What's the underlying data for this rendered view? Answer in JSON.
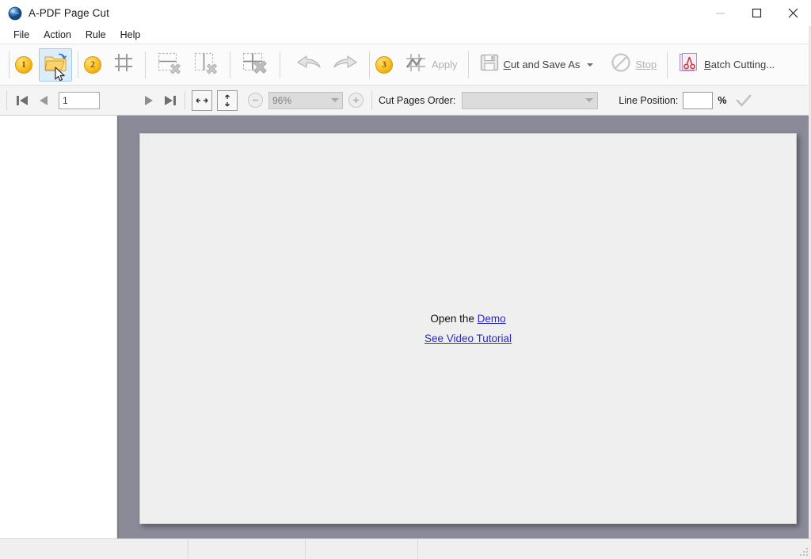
{
  "window": {
    "title": "A-PDF Page Cut",
    "app_icon": "globe-icon",
    "minimize_label": "Minimize",
    "maximize_label": "Maximize",
    "close_label": "Close"
  },
  "menubar": {
    "items": [
      {
        "label": "File"
      },
      {
        "label": "Action"
      },
      {
        "label": "Rule"
      },
      {
        "label": "Help"
      }
    ]
  },
  "toolbar": {
    "step1_badge": "1",
    "open_label": "Open",
    "step2_badge": "2",
    "grid_label": "Add Grid Lines",
    "del_h_label": "Delete Horizontal Line",
    "del_v_label": "Delete Vertical Line",
    "del_all_label": "Delete All Lines",
    "undo_label": "Undo",
    "redo_label": "Redo",
    "step3_badge": "3",
    "apply_label": "Apply",
    "cut_save_label": "Cut and Save As",
    "cut_save_accesskey": "C",
    "stop_label": "Stop",
    "batch_label": "Batch Cutting...",
    "batch_accesskey": "B"
  },
  "navbar": {
    "first_label": "First Page",
    "prev_label": "Previous Page",
    "page_value": "1",
    "page_placeholder": "",
    "next_label": "Next Page",
    "last_label": "Last Page",
    "fit_width_label": "Fit Width",
    "fit_height_label": "Fit Height",
    "zoom_out_label": "Zoom Out",
    "zoom_value": "96%",
    "zoom_in_label": "Zoom In",
    "cut_order_label": "Cut Pages Order:",
    "cut_order_value": "",
    "line_position_label": "Line Position:",
    "line_position_value": "",
    "line_position_placeholder": "",
    "percent_symbol": "%",
    "confirm_label": "Confirm"
  },
  "document": {
    "open_the_text": "Open the",
    "demo_link": "Demo",
    "video_link": "See Video Tutorial"
  },
  "statusbar": {
    "cells": [
      "",
      "",
      "",
      ""
    ]
  },
  "colors": {
    "badge_orange": "#fcc52a",
    "link_blue": "#2b28c7",
    "viewer_bg": "#8a8a99",
    "page_bg": "#efefef",
    "hover_blue": "#dbecfb"
  }
}
